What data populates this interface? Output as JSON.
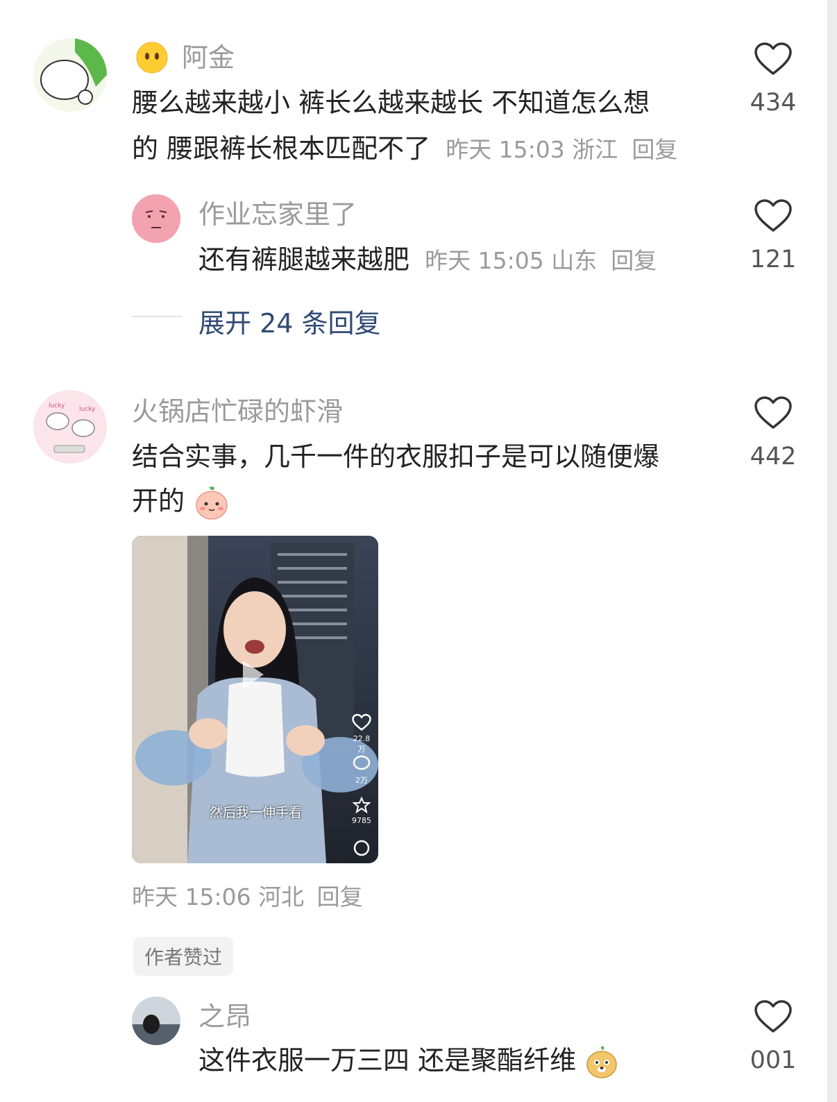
{
  "comments": [
    {
      "user": "阿金",
      "text_line1": "腰么越来越小 裤长么越来越长 不知道怎么想",
      "text_line2": "的 腰跟裤长根本匹配不了",
      "meta": "昨天 15:03 浙江",
      "reply_label": "回复",
      "likes": "434",
      "replies": [
        {
          "user": "作业忘家里了",
          "text": "还有裤腿越来越肥",
          "meta": "昨天 15:05 山东",
          "reply_label": "回复",
          "likes": "121"
        }
      ],
      "expand_label": "展开 24 条回复"
    },
    {
      "user": "火锅店忙碌的虾滑",
      "text_line1": "结合实事，几千一件的衣服扣子是可以随便爆",
      "text_line2": "开的",
      "meta": "昨天 15:06 河北",
      "reply_label": "回复",
      "likes": "442",
      "video": {
        "subtitle": "然后我一伸手看",
        "likes": "22.8万",
        "comments": "2万",
        "favorites": "9785"
      },
      "badge": "作者赞过",
      "replies": [
        {
          "user": "之昂",
          "text": "这件衣服一万三四 还是聚酯纤维",
          "likes": "001"
        }
      ]
    }
  ]
}
